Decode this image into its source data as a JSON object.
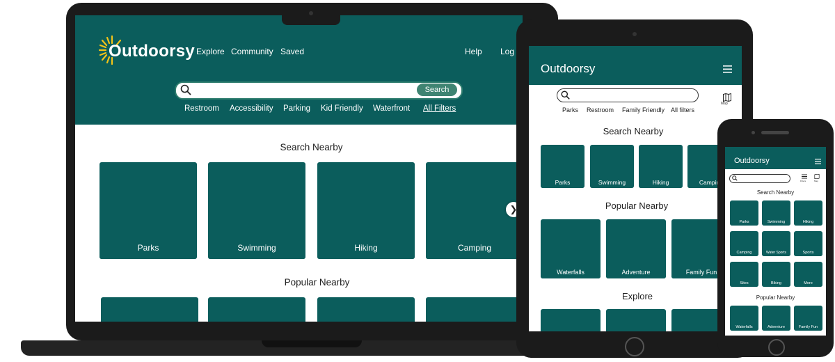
{
  "brand": "Outdoorsy",
  "laptop": {
    "nav": [
      "Explore",
      "Community",
      "Saved"
    ],
    "nav_right": [
      "Help",
      "Log I"
    ],
    "search_button": "Search",
    "filters": [
      "Restroom",
      "Accessibility",
      "Parking",
      "Kid Friendly",
      "Waterfront",
      "All Filters"
    ],
    "section_nearby": "Search Nearby",
    "nearby": [
      "Parks",
      "Swimming",
      "Hiking",
      "Camping"
    ],
    "section_popular": "Popular Nearby"
  },
  "tablet": {
    "filters": [
      "Parks",
      "Restroom",
      "Family Friendly",
      "All filters"
    ],
    "map_label": "Map",
    "section_nearby": "Search Nearby",
    "nearby": [
      "Parks",
      "Swimming",
      "Hiking",
      "Campin"
    ],
    "section_popular": "Popular Nearby",
    "popular": [
      "Waterfalls",
      "Adventure",
      "Family Fun"
    ],
    "section_explore": "Explore"
  },
  "phone": {
    "icon_labels": [
      "Filters",
      "Map"
    ],
    "section_nearby": "Search Nearby",
    "grid": [
      "Parks",
      "Swimming",
      "Hiking",
      "Camping",
      "Water Sports",
      "Sports",
      "Sites",
      "Biking",
      "More"
    ],
    "section_popular": "Popular Nearby",
    "popular": [
      "Waterfalls",
      "Adventure",
      "Family Fun"
    ]
  },
  "colors": {
    "brand_teal": "#0b5d5c",
    "sun_yellow": "#f3c318",
    "search_button": "#3f8472"
  }
}
